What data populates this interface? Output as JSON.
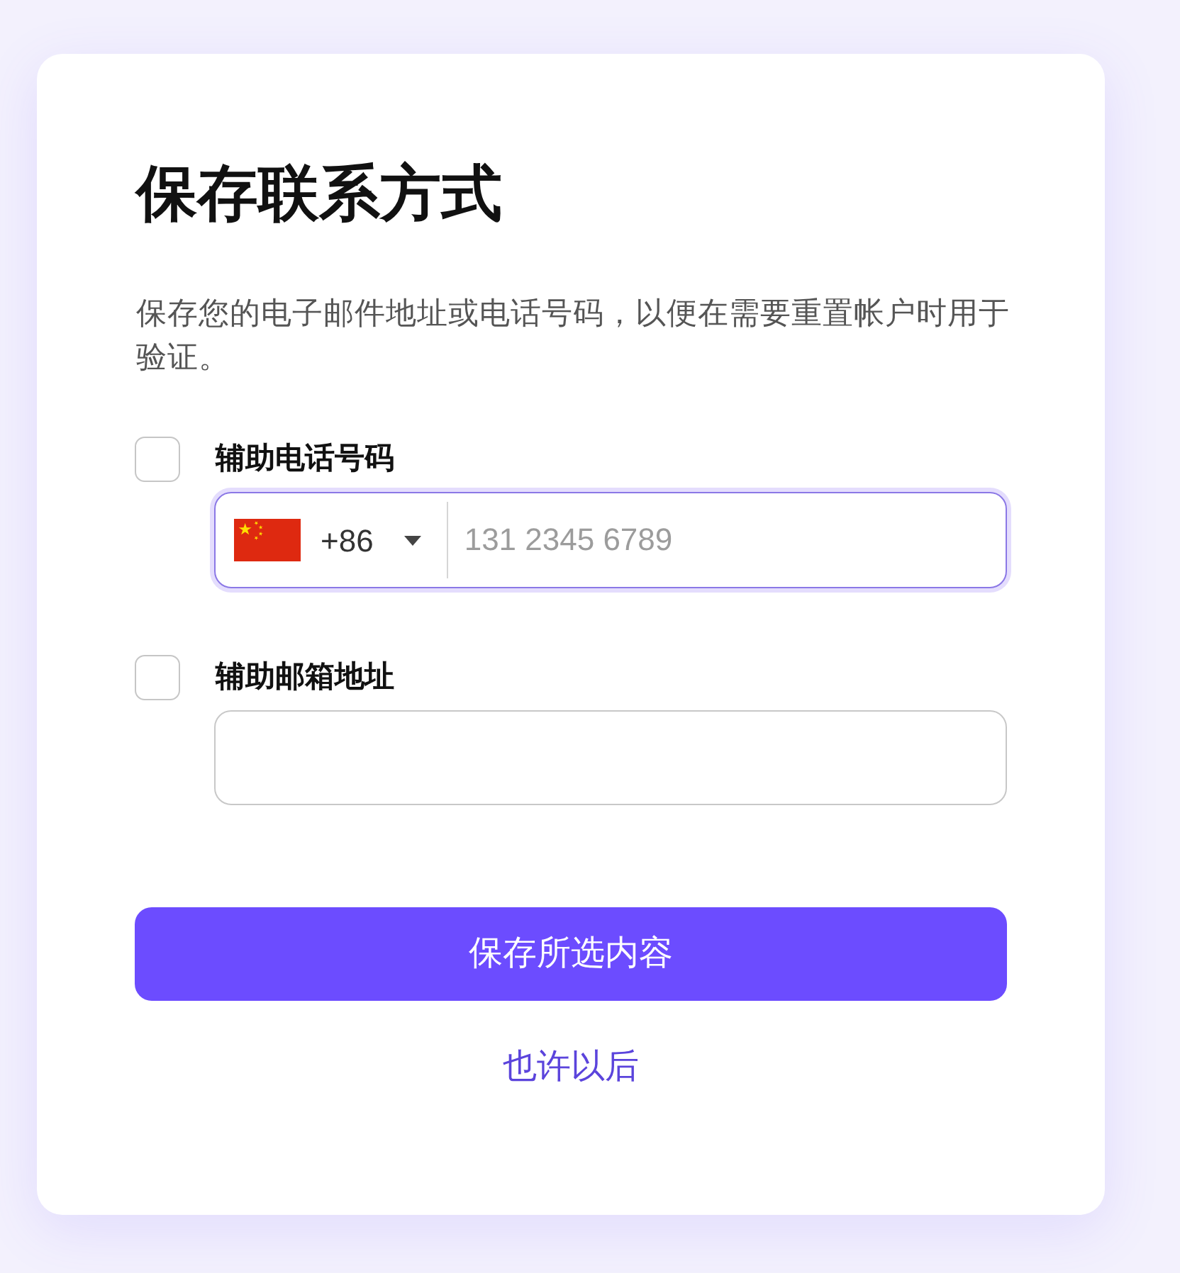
{
  "dialog": {
    "title": "保存联系方式",
    "description": "保存您的电子邮件地址或电话号码，以便在需要重置帐户时用于验证。"
  },
  "options": [
    {
      "kind": "phone",
      "label": "辅助电话号码",
      "checked": false,
      "focused": true,
      "country_code": "+86",
      "placeholder": "131 2345 6789"
    },
    {
      "kind": "email",
      "label": "辅助邮箱地址",
      "checked": false,
      "focused": false
    }
  ],
  "buttons": [
    {
      "kind": "primary",
      "label": "保存所选内容"
    },
    {
      "kind": "link",
      "label": "也许以后"
    }
  ]
}
